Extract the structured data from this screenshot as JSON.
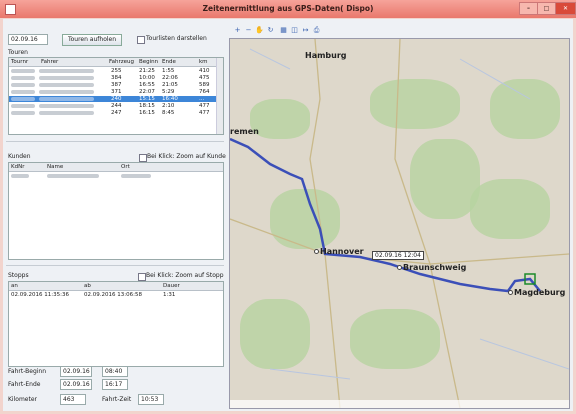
{
  "window": {
    "title": "Zeitenermittlung aus GPS-Daten( Dispo)"
  },
  "tours": {
    "date_value": "02.09.16",
    "load_button": "Touren aufholen",
    "show_all_label": "Tourlisten darstellen",
    "section_label": "Touren",
    "columns": [
      "Tournr",
      "Fahrer",
      "Fahrzeug",
      "Beginn",
      "Ende",
      "km"
    ],
    "rows": [
      {
        "vehicle": "255",
        "start": "21:25",
        "end": "1:55",
        "km": "410"
      },
      {
        "vehicle": "384",
        "start": "10:00",
        "end": "22:06",
        "km": "475"
      },
      {
        "vehicle": "387",
        "start": "16:55",
        "end": "21:05",
        "km": "589"
      },
      {
        "vehicle": "371",
        "start": "22:07",
        "end": "5:29",
        "km": "764"
      },
      {
        "vehicle": "240",
        "start": "15:15",
        "end": "16:40",
        "km": "..."
      },
      {
        "vehicle": "244",
        "start": "18:15",
        "end": "2:10",
        "km": "477"
      },
      {
        "vehicle": "247",
        "start": "16:15",
        "end": "8:45",
        "km": "477"
      }
    ]
  },
  "customers": {
    "section_label": "Kunden",
    "zoom_label": "Bei Klick: Zoom auf Kunde",
    "columns": [
      "KdNr",
      "Name",
      "Ort"
    ]
  },
  "stops": {
    "section_label": "Stopps",
    "zoom_label": "Bei Klick: Zoom auf Stopp",
    "columns": [
      "an",
      "ab",
      "Dauer"
    ],
    "rows": [
      {
        "arrival": "02.09.2016 11:35:36",
        "departure": "02.09.2016 13:06:58",
        "duration": "1:31"
      }
    ]
  },
  "summary": {
    "start_label": "Fahrt-Beginn",
    "start_date": "02.09.16",
    "start_time": "08:40",
    "end_label": "Fahrt-Ende",
    "end_date": "02.09.16",
    "end_time": "16:17",
    "km_label": "Kilometer",
    "km_value": "463",
    "time_label": "Fahrt-Zeit",
    "time_value": "10:53"
  },
  "map": {
    "cities": {
      "hamburg": "Hamburg",
      "bremen": "remen",
      "hannover": "Hannover",
      "braunschweig": "Braunschweig",
      "magdeburg": "Magdeburg"
    },
    "callout": "02.09.16 12:04",
    "route_color": "#3b4fb8"
  },
  "icons": [
    "zoom-in-icon",
    "zoom-out-icon",
    "pan-icon",
    "refresh-icon",
    "grid-icon",
    "layers-icon",
    "ruler-icon",
    "print-icon"
  ]
}
